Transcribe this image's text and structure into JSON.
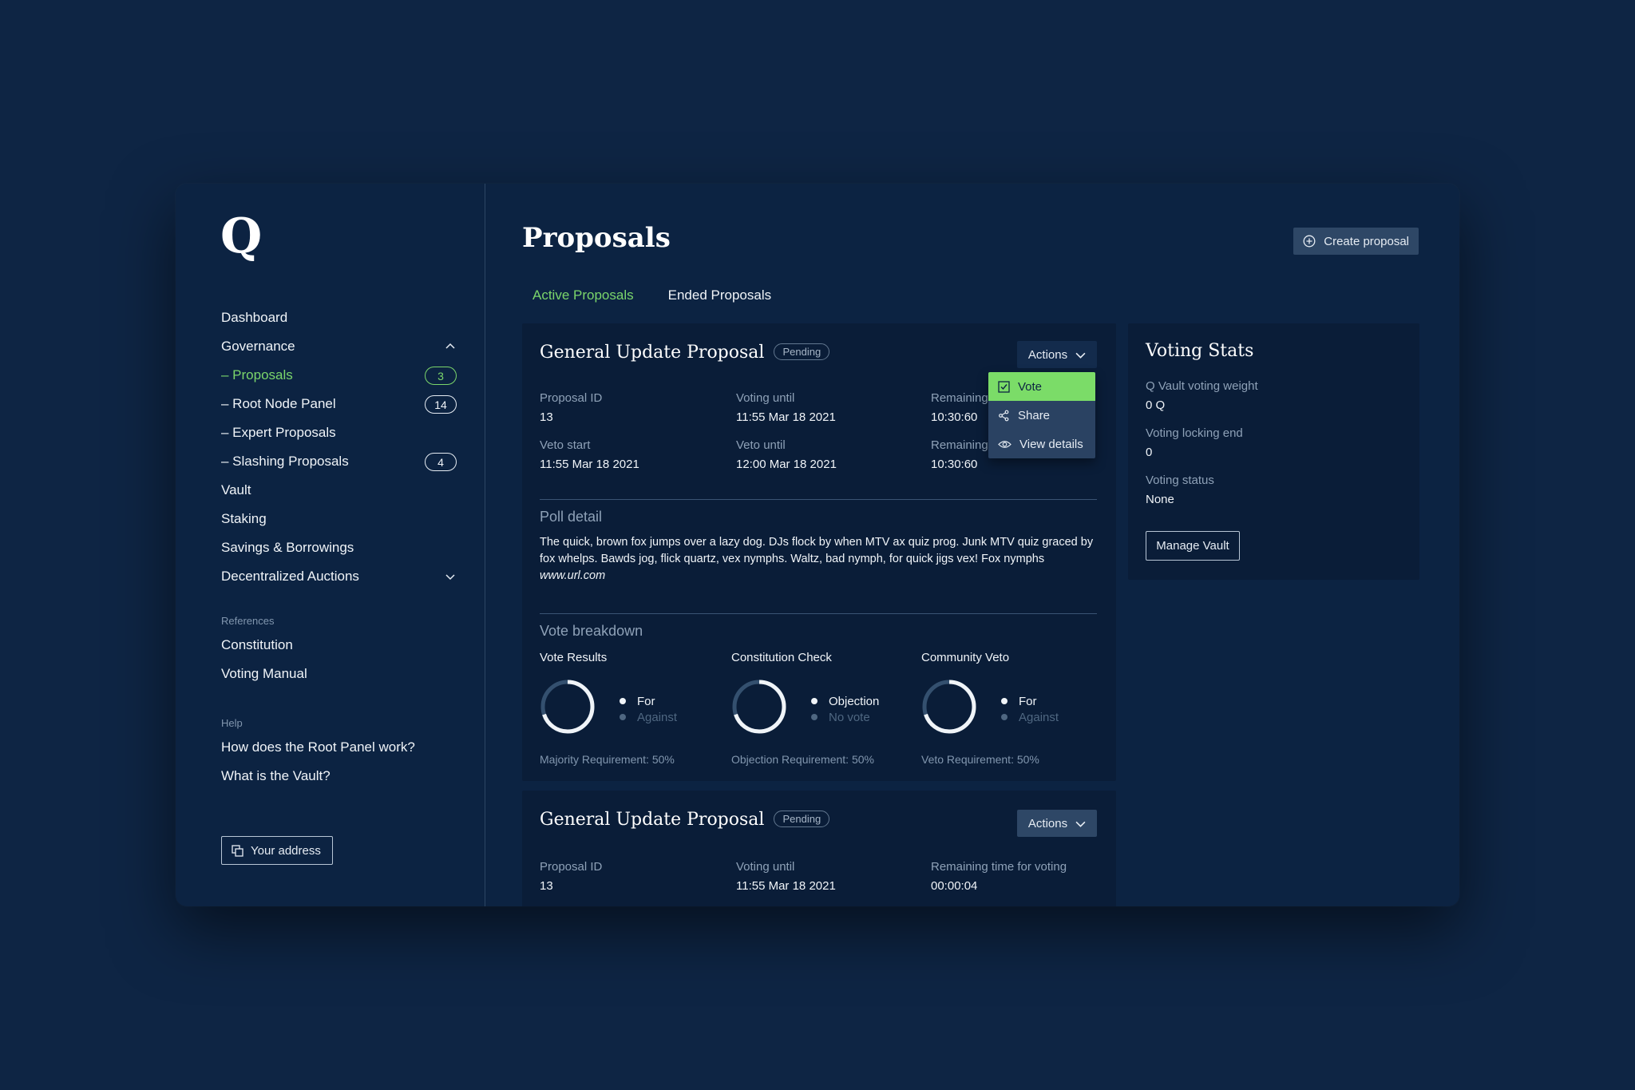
{
  "brand": {
    "logo": "Q"
  },
  "sidebar": {
    "nav": [
      {
        "label": "Dashboard"
      },
      {
        "label": "Governance"
      },
      {
        "label": "– Proposals",
        "badge": "3"
      },
      {
        "label": "– Root Node Panel",
        "badge": "14"
      },
      {
        "label": "– Expert Proposals"
      },
      {
        "label": "– Slashing Proposals",
        "badge": "4"
      },
      {
        "label": "Vault"
      },
      {
        "label": "Staking"
      },
      {
        "label": "Savings & Borrowings"
      },
      {
        "label": "Decentralized Auctions"
      }
    ],
    "references_label": "References",
    "references": [
      {
        "label": "Constitution"
      },
      {
        "label": "Voting Manual"
      }
    ],
    "help_label": "Help",
    "help": [
      {
        "label": "How does the Root Panel work?"
      },
      {
        "label": "What is the Vault?"
      }
    ],
    "address_button": "Your address"
  },
  "main": {
    "title": "Proposals",
    "create_button": "Create proposal",
    "tabs": [
      {
        "label": "Active Proposals",
        "active": true
      },
      {
        "label": "Ended Proposals",
        "active": false
      }
    ]
  },
  "proposal1": {
    "title": "General Update Proposal",
    "status": "Pending",
    "actions_label": "Actions",
    "fields": {
      "proposal_id_label": "Proposal ID",
      "proposal_id": "13",
      "voting_until_label": "Voting until",
      "voting_until": "11:55 Mar 18 2021",
      "remaining1_label": "Remaining",
      "remaining1": "10:30:60",
      "veto_start_label": "Veto start",
      "veto_start": "11:55 Mar 18 2021",
      "veto_until_label": "Veto until",
      "veto_until": "12:00 Mar 18 2021",
      "remaining2_label": "Remaining",
      "remaining2": "10:30:60"
    },
    "dropdown": [
      {
        "label": "Vote"
      },
      {
        "label": "Share"
      },
      {
        "label": "View details"
      }
    ],
    "poll_title": "Poll detail",
    "poll_text": "The quick, brown fox jumps over a lazy dog. DJs flock by when MTV ax quiz prog. Junk MTV quiz graced by fox whelps. Bawds jog, flick quartz, vex nymphs. Waltz, bad nymph, for quick jigs vex! Fox nymphs",
    "poll_url": "www.url.com",
    "breakdown_title": "Vote breakdown",
    "breakdown": [
      {
        "title": "Vote Results",
        "on": "For",
        "off": "Against",
        "requirement": "Majority Requirement: 50%"
      },
      {
        "title": "Constitution Check",
        "on": "Objection",
        "off": "No vote",
        "requirement": "Objection Requirement: 50%"
      },
      {
        "title": "Community Veto",
        "on": "For",
        "off": "Against",
        "requirement": "Veto Requirement: 50%"
      }
    ]
  },
  "proposal2": {
    "title": "General Update Proposal",
    "status": "Pending",
    "actions_label": "Actions",
    "proposal_id_label": "Proposal ID",
    "proposal_id": "13",
    "voting_until_label": "Voting until",
    "voting_until": "11:55 Mar 18 2021",
    "remaining_label": "Remaining time for voting",
    "remaining": "00:00:04"
  },
  "stats": {
    "title": "Voting Stats",
    "weight_label": "Q Vault voting weight",
    "weight": "0 Q",
    "locking_label": "Voting locking end",
    "locking": "0",
    "status_label": "Voting status",
    "status": "None",
    "manage_button": "Manage Vault"
  },
  "colors": {
    "accent_green": "#7bd66b",
    "background": "#0e2544",
    "card": "#0a1d38"
  }
}
